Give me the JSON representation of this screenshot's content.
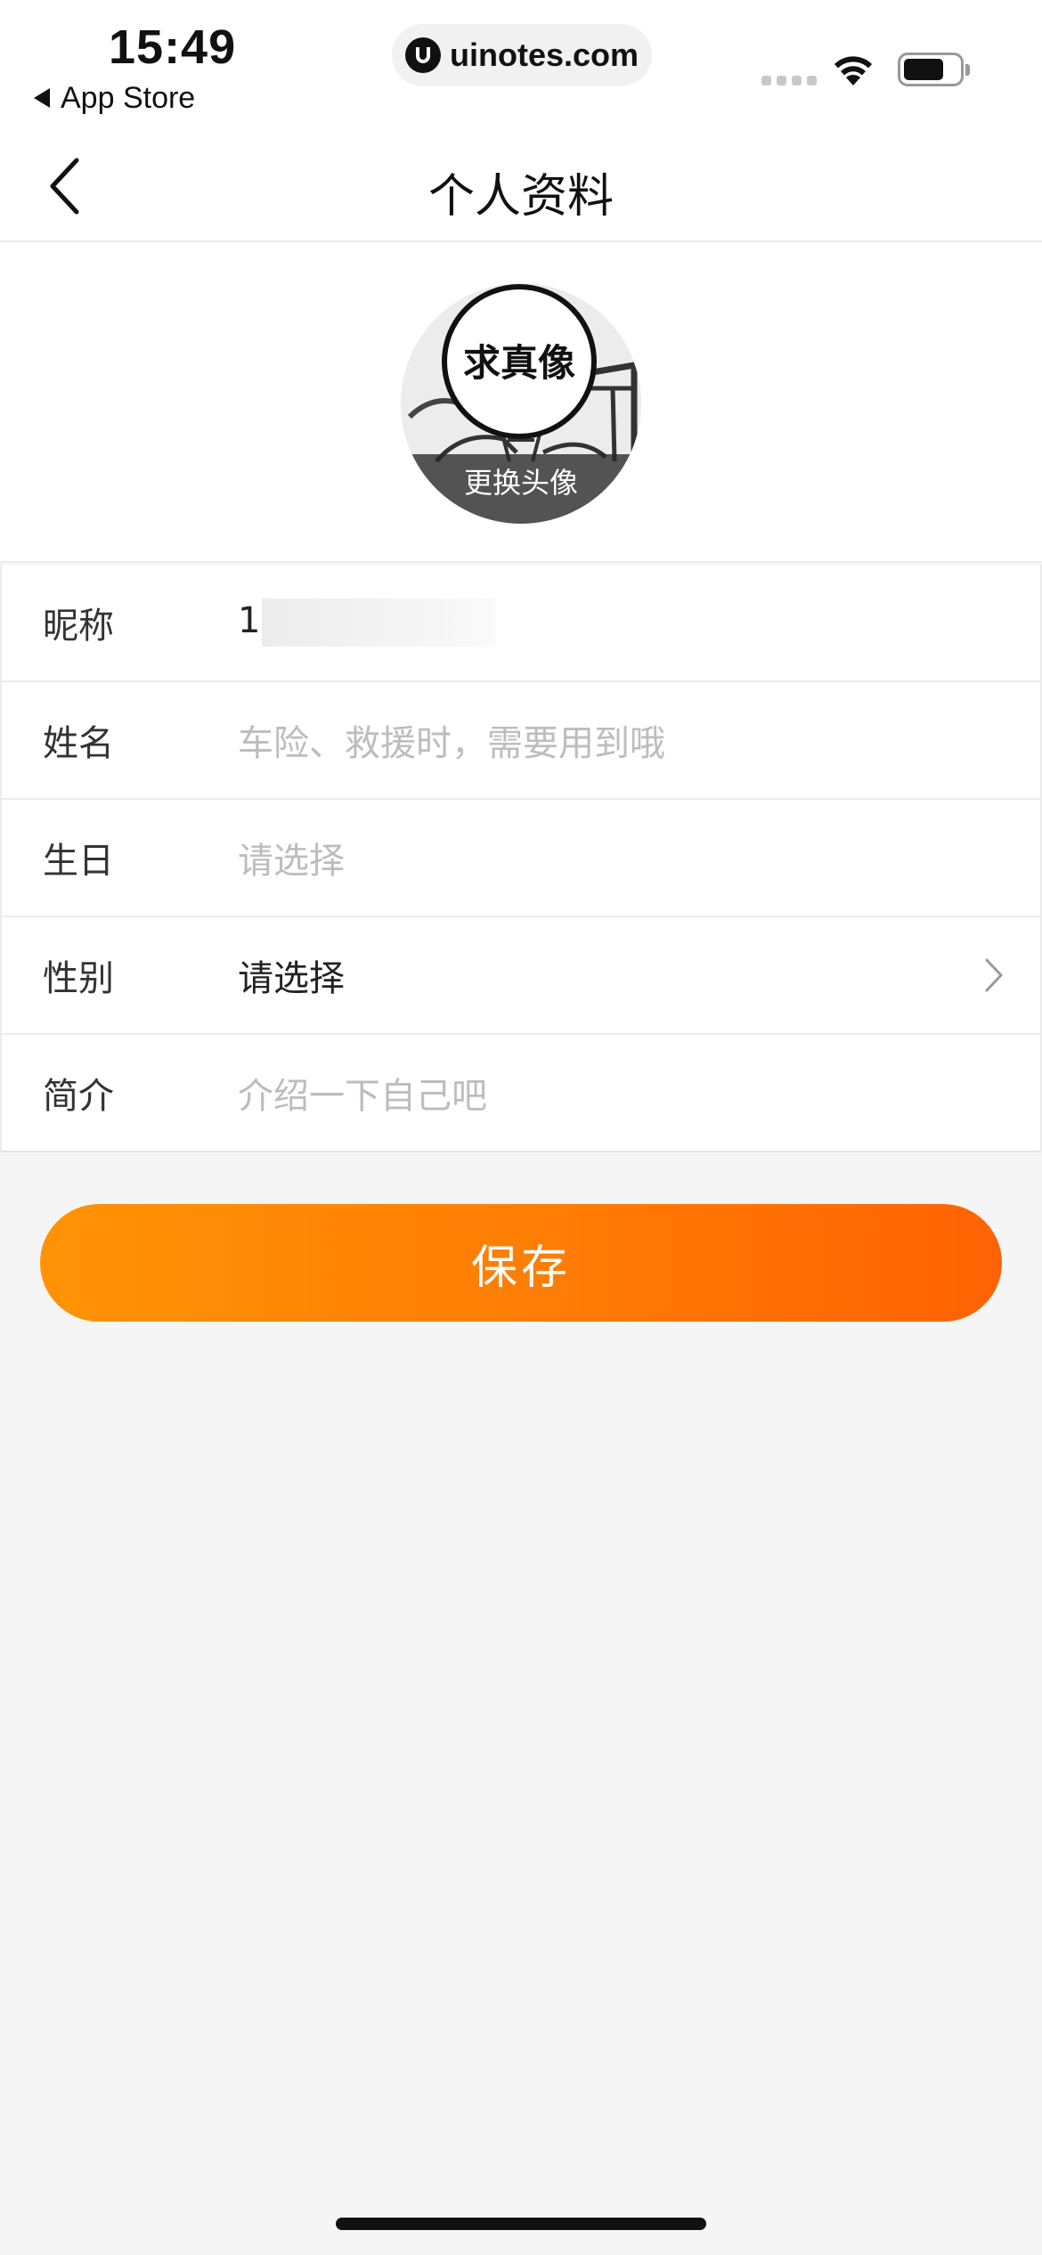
{
  "status_bar": {
    "time": "15:49",
    "back_app_label": "App Store",
    "url": "uinotes.com"
  },
  "nav": {
    "title": "个人资料"
  },
  "avatar": {
    "badge_text": "求真像",
    "caption": "更换头像"
  },
  "form": {
    "rows": [
      {
        "label": "昵称",
        "value": "1"
      },
      {
        "label": "姓名",
        "placeholder": "车险、救援时，需要用到哦"
      },
      {
        "label": "生日",
        "placeholder": "请选择"
      },
      {
        "label": "性别",
        "value": "请选择"
      },
      {
        "label": "简介",
        "placeholder": "介绍一下自己吧"
      }
    ]
  },
  "save_button": {
    "label": "保存"
  },
  "colors": {
    "accent_start": "#ff9306",
    "accent_end": "#ff6203",
    "page_background": "#f5f5f5",
    "placeholder": "#bdbdbd"
  }
}
